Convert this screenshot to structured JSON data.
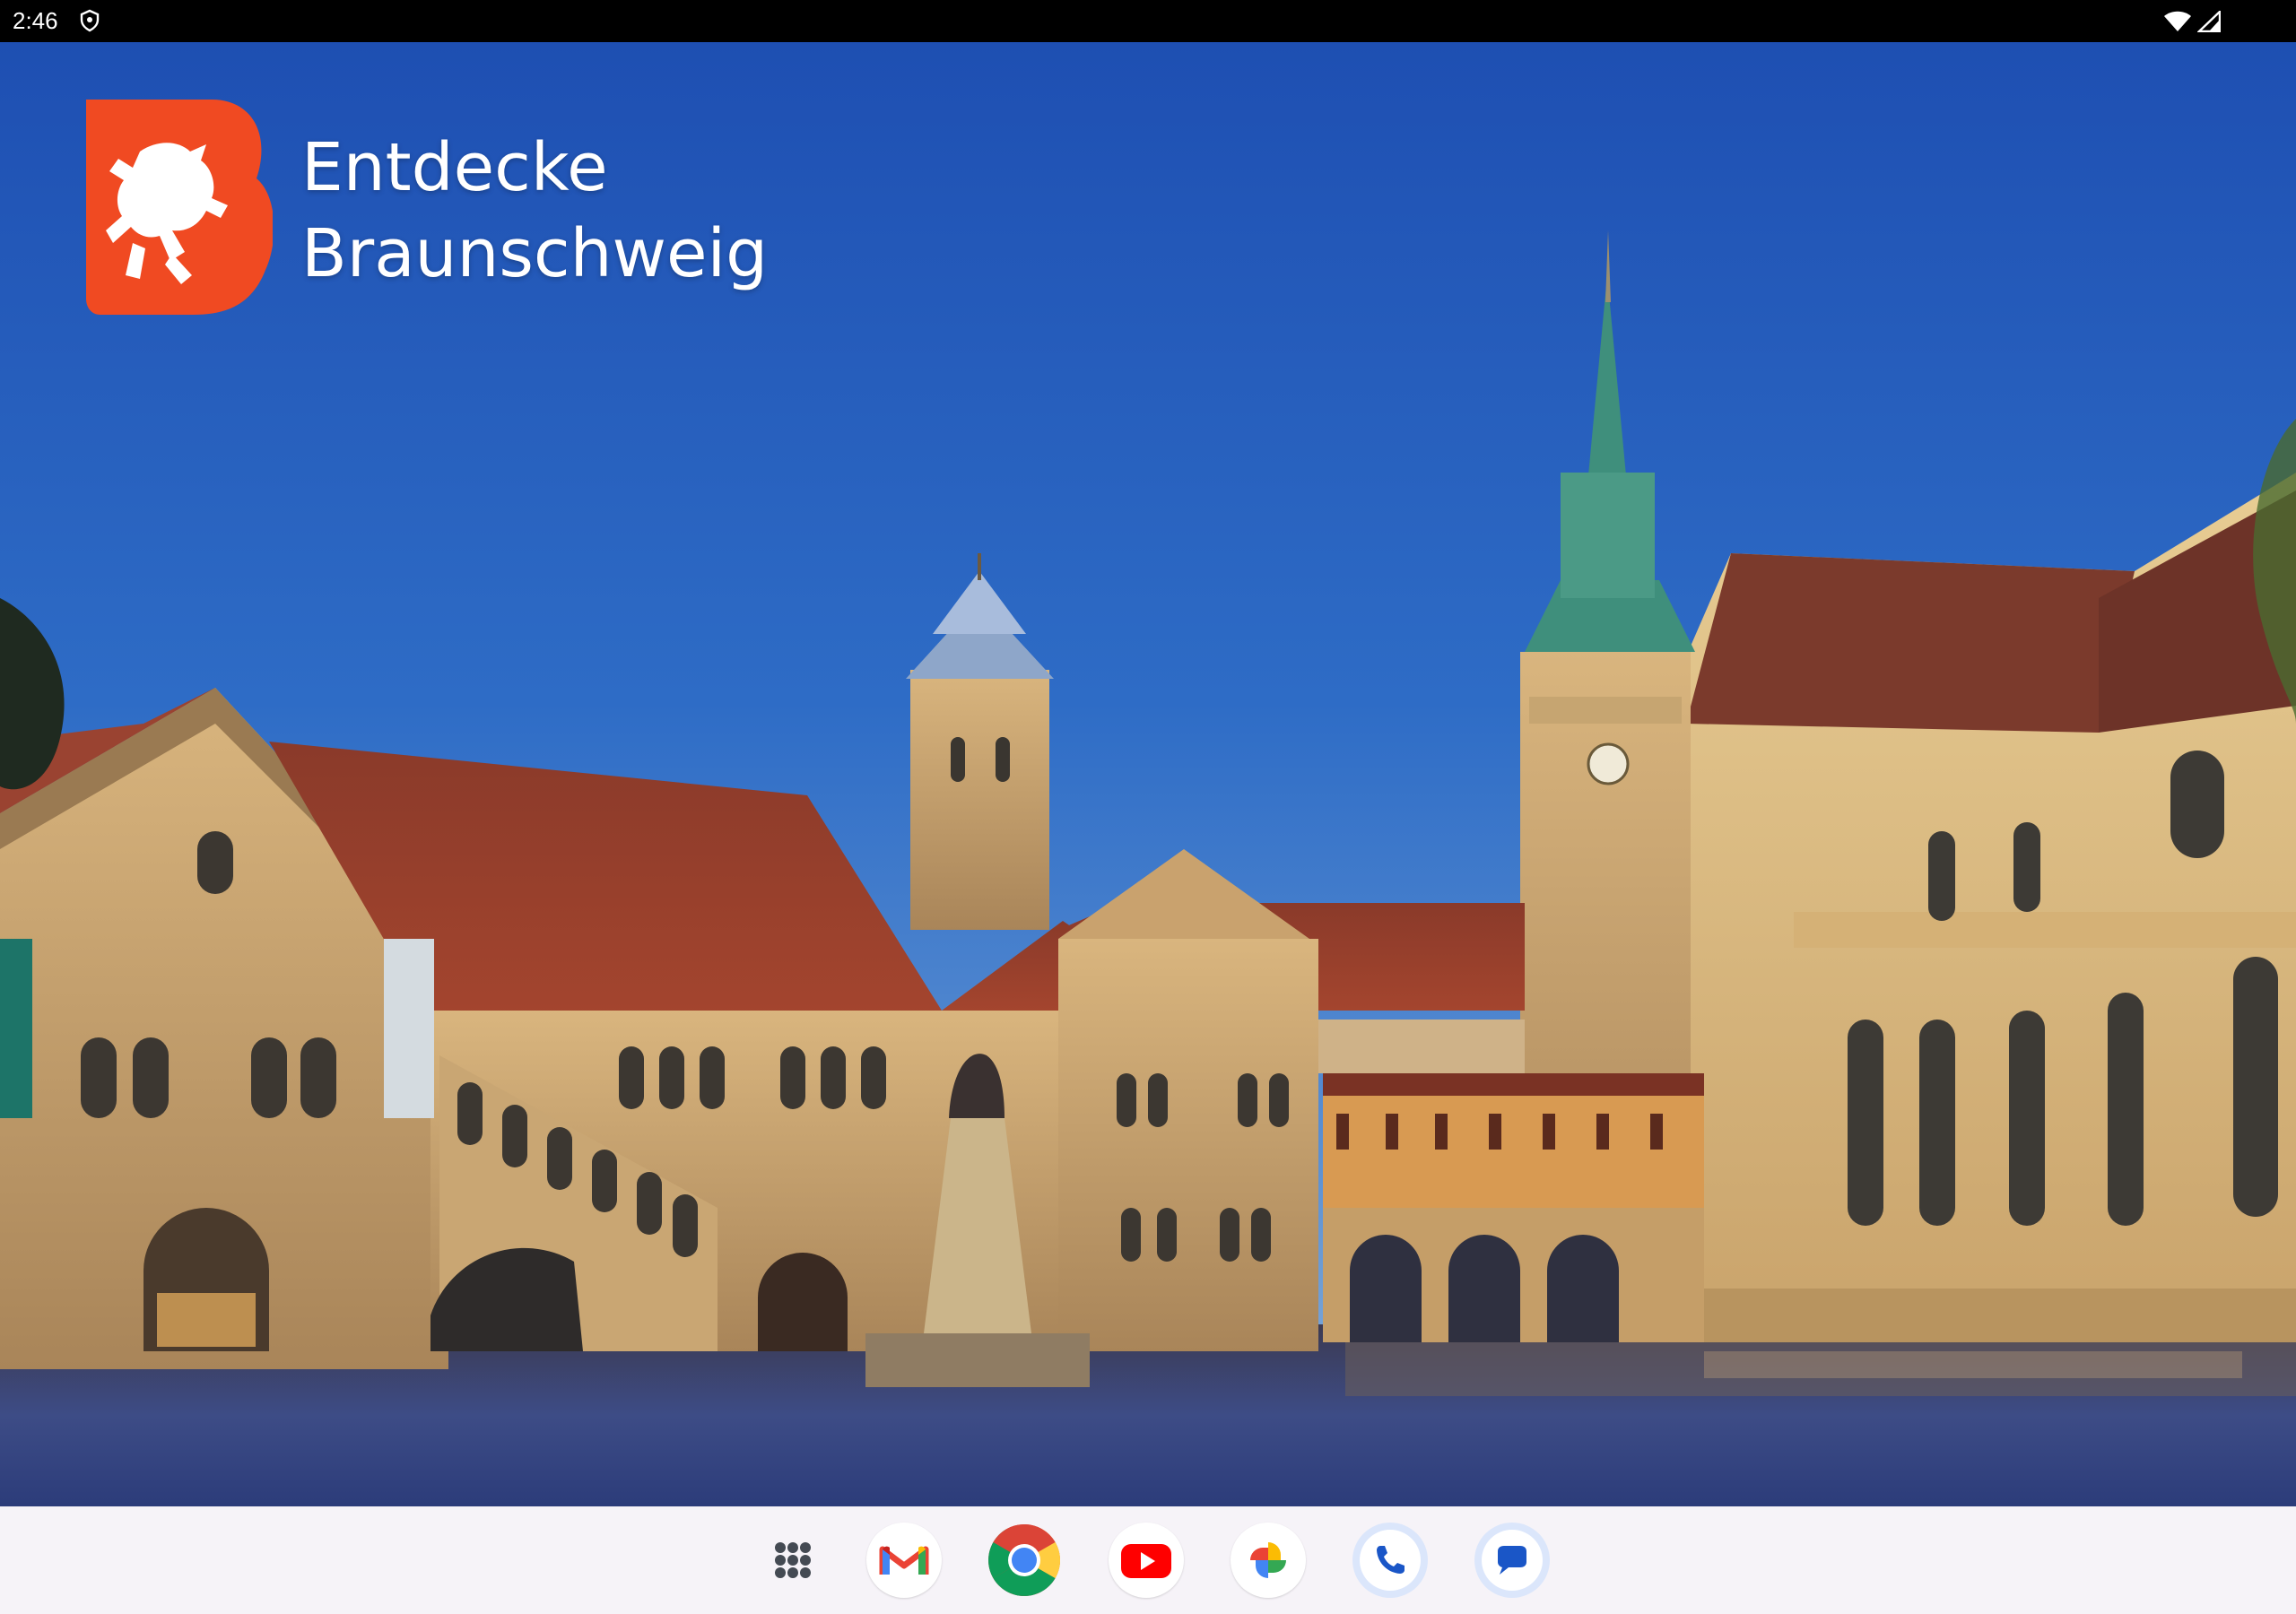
{
  "status_bar": {
    "time": "2:46",
    "notification_icon": "location-shield-icon",
    "wifi_icon": "wifi-icon",
    "signal_icon": "cell-signal-icon"
  },
  "wallpaper": {
    "logo": {
      "icon": "braunschweig-lion-logo",
      "color": "#f04a22",
      "line1": "Entdecke",
      "line2": "Braunschweig"
    },
    "scene": "Burgplatz with Dankwarderode Castle, Lion Monument, Town Hall tower and Cathedral at dusk"
  },
  "dock": {
    "background": "#f6f3f8",
    "items": [
      {
        "name": "App drawer",
        "icon": "apps-grid-icon"
      },
      {
        "name": "Gmail",
        "icon": "gmail-icon"
      },
      {
        "name": "Chrome",
        "icon": "chrome-icon"
      },
      {
        "name": "YouTube",
        "icon": "youtube-icon"
      },
      {
        "name": "Photos",
        "icon": "photos-icon"
      },
      {
        "name": "Phone",
        "icon": "phone-icon"
      },
      {
        "name": "Messages",
        "icon": "messages-icon"
      }
    ]
  }
}
